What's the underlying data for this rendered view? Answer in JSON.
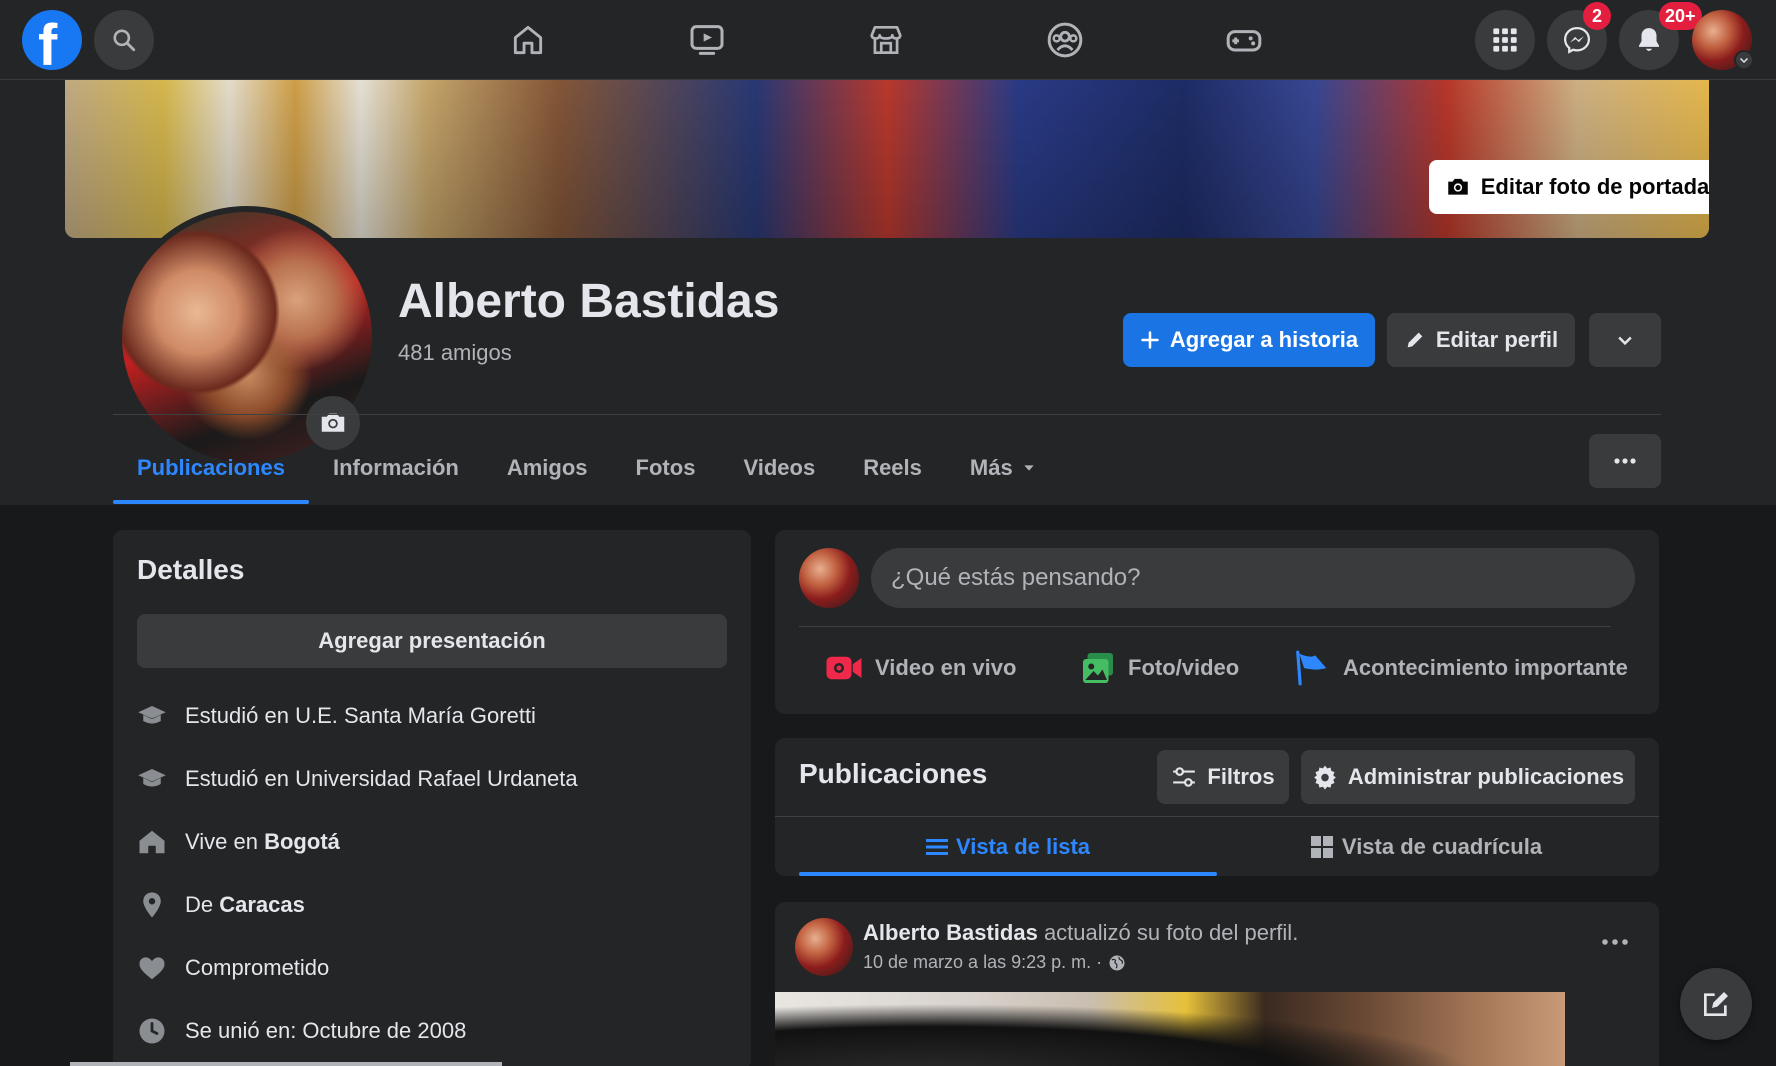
{
  "topnav": {
    "logo_letter": "f",
    "messenger_badge": "2",
    "notifications_badge": "20+"
  },
  "profile": {
    "edit_cover_label": "Editar foto de portada",
    "name": "Alberto Bastidas",
    "friends": "481 amigos",
    "add_story_label": "Agregar a historia",
    "edit_profile_label": "Editar perfil"
  },
  "tabs": [
    {
      "label": "Publicaciones"
    },
    {
      "label": "Información"
    },
    {
      "label": "Amigos"
    },
    {
      "label": "Fotos"
    },
    {
      "label": "Videos"
    },
    {
      "label": "Reels"
    },
    {
      "label": "Más"
    }
  ],
  "details": {
    "title": "Detalles",
    "add_presentation_label": "Agregar presentación",
    "rows": [
      {
        "text": "Estudió en U.E. Santa María Goretti"
      },
      {
        "text": "Estudió en Universidad Rafael Urdaneta"
      },
      {
        "prefix": "Vive en ",
        "bold": "Bogotá"
      },
      {
        "prefix": "De ",
        "bold": "Caracas"
      },
      {
        "text": "Comprometido"
      },
      {
        "text": "Se unió en: Octubre de 2008"
      }
    ]
  },
  "composer": {
    "placeholder": "¿Qué estás pensando?",
    "live_label": "Video en vivo",
    "photo_label": "Foto/video",
    "event_label": "Acontecimiento importante"
  },
  "posts_section": {
    "title": "Publicaciones",
    "filters_label": "Filtros",
    "manage_label": "Administrar publicaciones",
    "list_view_label": "Vista de lista",
    "grid_view_label": "Vista de cuadrícula"
  },
  "post": {
    "author": "Alberto Bastidas",
    "action": " actualizó su foto del perfil.",
    "timestamp": "10 de marzo a las 9:23 p. m. ·"
  },
  "colors": {
    "accent": "#2d88ff",
    "primary_button": "#1b74e4",
    "background": "#18191a",
    "surface": "#242526",
    "badge": "#e41e3f"
  }
}
